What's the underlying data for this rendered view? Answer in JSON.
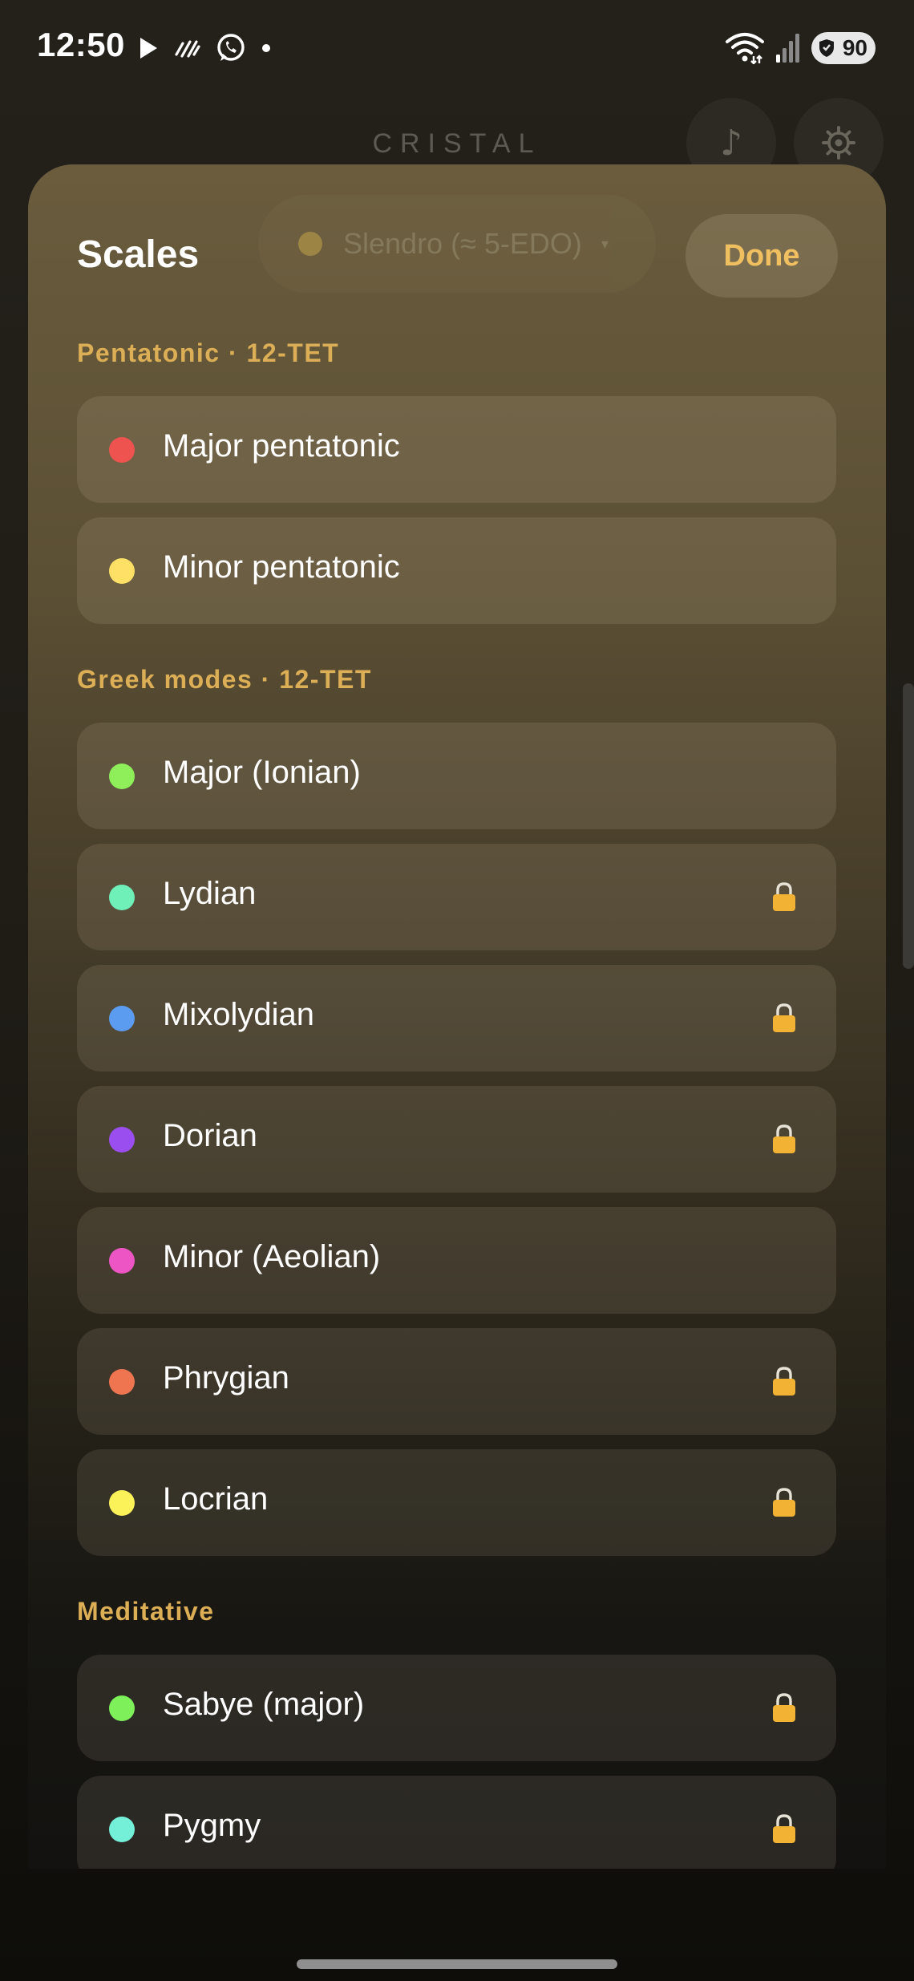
{
  "status_bar": {
    "time": "12:50",
    "left_icons": [
      "play-icon",
      "data-saver-icon",
      "whatsapp-icon",
      "dot-icon"
    ],
    "right_icons": [
      "wifi-icon",
      "signal-icon"
    ],
    "battery_level": "90"
  },
  "app": {
    "title": "CRISTAL",
    "music_glyph": "♪",
    "settings_icon": "gear-icon"
  },
  "sheet": {
    "title": "Scales",
    "done_label": "Done",
    "current_scale": {
      "label": "Slendro (≈ 5-EDO)",
      "caret": "▾",
      "dot_color": "#c9a94d"
    },
    "sections": [
      {
        "label": "Pentatonic · 12-TET",
        "items": [
          {
            "name": "Major pentatonic",
            "color": "#ef5350",
            "locked": false
          },
          {
            "name": "Minor pentatonic",
            "color": "#ffe066",
            "locked": false
          }
        ]
      },
      {
        "label": "Greek modes · 12-TET",
        "items": [
          {
            "name": "Major (Ionian)",
            "color": "#8eef5a",
            "locked": false
          },
          {
            "name": "Lydian",
            "color": "#6ef0b8",
            "locked": true
          },
          {
            "name": "Mixolydian",
            "color": "#5b9cf0",
            "locked": true
          },
          {
            "name": "Dorian",
            "color": "#9b4ef0",
            "locked": true
          },
          {
            "name": "Minor (Aeolian)",
            "color": "#ee55c4",
            "locked": false
          },
          {
            "name": "Phrygian",
            "color": "#ef7550",
            "locked": true
          },
          {
            "name": "Locrian",
            "color": "#fbf25a",
            "locked": true
          }
        ]
      },
      {
        "label": "Meditative",
        "items": [
          {
            "name": "Sabye (major)",
            "color": "#7ef05a",
            "locked": true
          },
          {
            "name": "Pygmy",
            "color": "#74f0d9",
            "locked": true
          }
        ]
      }
    ]
  },
  "colors": {
    "accent": "#f0c060",
    "section_label": "#dcae55",
    "lock": "#f2b234"
  }
}
